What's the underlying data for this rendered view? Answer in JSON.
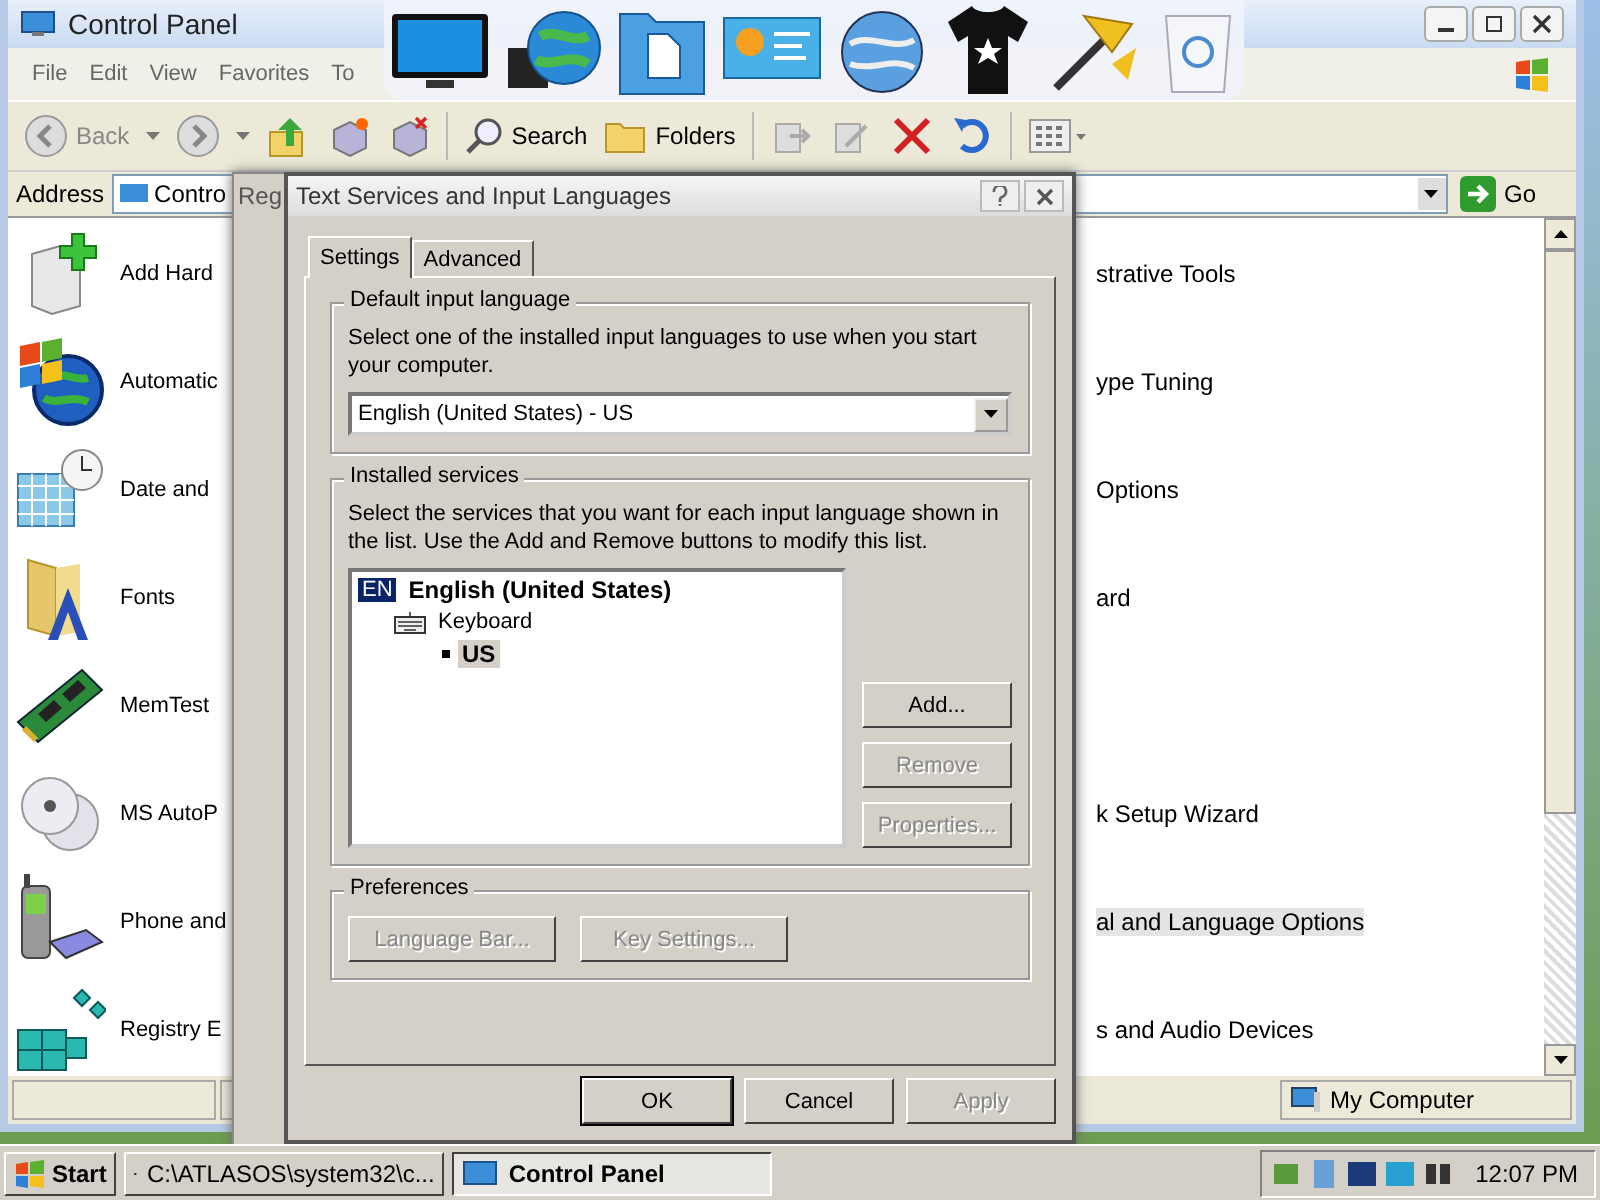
{
  "control_panel": {
    "title": "Control Panel",
    "menu": [
      "File",
      "Edit",
      "View",
      "Favorites",
      "To"
    ],
    "toolbar": {
      "back": "Back",
      "search": "Search",
      "folders": "Folders"
    },
    "address": {
      "label": "Address",
      "value": "Contro",
      "go": "Go"
    },
    "left_items": [
      {
        "label": "Add Hard"
      },
      {
        "label": "Automatic"
      },
      {
        "label": "Date and"
      },
      {
        "label": "Fonts"
      },
      {
        "label": "MemTest"
      },
      {
        "label": "MS AutoP"
      },
      {
        "label": "Phone and"
      },
      {
        "label": "Registry E"
      }
    ],
    "right_items": [
      {
        "label": "strative Tools",
        "selected": false
      },
      {
        "label": "ype Tuning",
        "selected": false
      },
      {
        "label": "Options",
        "selected": false
      },
      {
        "label": "ard",
        "selected": false
      },
      {
        "label": "k Setup Wizard",
        "selected": false
      },
      {
        "label": "al and Language Options",
        "selected": true
      },
      {
        "label": "s and Audio Devices",
        "selected": false
      }
    ],
    "status_bar": {
      "location": "My Computer"
    }
  },
  "back_dialog": {
    "title": "Reg"
  },
  "dialog": {
    "title": "Text Services and Input Languages",
    "tabs": [
      {
        "label": "Settings",
        "selected": true
      },
      {
        "label": "Advanced",
        "selected": false
      }
    ],
    "default_language": {
      "heading": "Default input language",
      "description": "Select one of the installed input languages to use when you start your computer.",
      "value": "English (United States) - US"
    },
    "installed_services": {
      "heading": "Installed services",
      "description": "Select the services that you want for each input language shown in the list. Use the Add and Remove buttons to modify this list.",
      "tree": [
        {
          "badge": "EN",
          "label": "English (United States)",
          "selected": false,
          "children": [
            {
              "label": "Keyboard",
              "selected": false,
              "children": [
                {
                  "label": "US",
                  "selected": true
                }
              ]
            }
          ]
        }
      ],
      "buttons": [
        {
          "label": "Add...",
          "disabled": false
        },
        {
          "label": "Remove",
          "disabled": true
        },
        {
          "label": "Properties...",
          "disabled": true
        }
      ]
    },
    "preferences": {
      "heading": "Preferences",
      "buttons": [
        {
          "label": "Language Bar...",
          "disabled": true
        },
        {
          "label": "Key Settings...",
          "disabled": true
        }
      ]
    },
    "buttons": [
      {
        "label": "OK",
        "default": true,
        "disabled": false
      },
      {
        "label": "Cancel",
        "default": false,
        "disabled": false
      },
      {
        "label": "Apply",
        "default": false,
        "disabled": true
      }
    ]
  },
  "taskbar": {
    "start": "Start",
    "tasks": [
      {
        "label": "C:\\ATLASOS\\system32\\c...",
        "selected": false
      },
      {
        "label": "Control Panel",
        "selected": true
      }
    ],
    "clock": "12:07 PM"
  }
}
